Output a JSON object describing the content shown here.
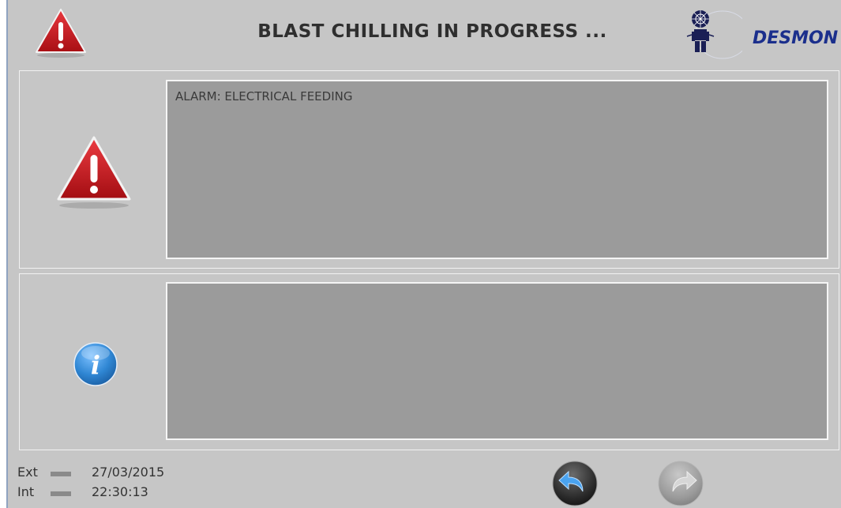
{
  "header": {
    "title": "BLAST CHILLING IN PROGRESS ...",
    "logo_text": "DESMON",
    "warning_icon": "warning-triangle-icon"
  },
  "alarm_panel": {
    "icon": "warning-triangle-icon",
    "message": "ALARM: ELECTRICAL FEEDING"
  },
  "info_panel": {
    "icon": "info-icon",
    "message": ""
  },
  "status": {
    "ext_label": "Ext",
    "ext_value": "27/03/2015",
    "int_label": "Int",
    "int_value": "22:30:13"
  },
  "nav": {
    "back_icon": "back-arrow-icon",
    "forward_icon": "forward-arrow-icon"
  },
  "colors": {
    "background": "#c6c6c6",
    "message_box": "#9b9b9b",
    "alarm_red": "#c4161c",
    "info_blue": "#2f86d3",
    "logo_blue": "#1b2f8c"
  }
}
